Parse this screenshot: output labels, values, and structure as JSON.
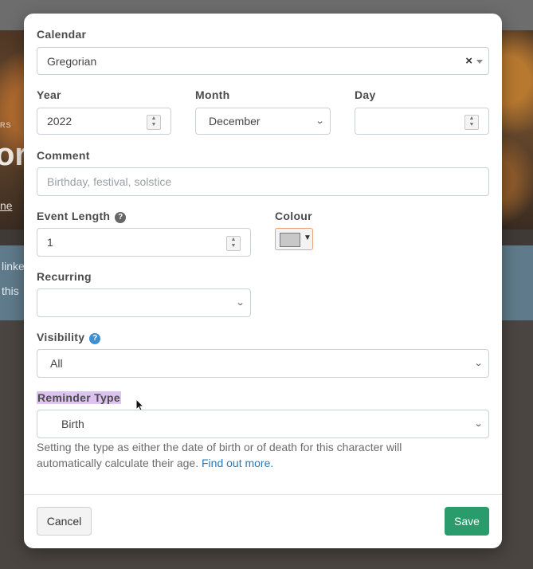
{
  "background": {
    "hero_small": "RS",
    "hero_big": "or",
    "hero_link": "ne",
    "alert_line1": "linke",
    "alert_line2": "this"
  },
  "form": {
    "calendar": {
      "label": "Calendar",
      "value": "Gregorian",
      "clear": "×"
    },
    "year": {
      "label": "Year",
      "value": "2022"
    },
    "month": {
      "label": "Month",
      "value": "December"
    },
    "day": {
      "label": "Day",
      "value": ""
    },
    "comment": {
      "label": "Comment",
      "placeholder": "Birthday, festival, solstice"
    },
    "event_length": {
      "label": "Event Length",
      "value": "1",
      "help_icon": "question-icon"
    },
    "colour": {
      "label": "Colour",
      "swatch": "#c8c8c8"
    },
    "recurring": {
      "label": "Recurring",
      "value": ""
    },
    "visibility": {
      "label": "Visibility",
      "value": "All",
      "help_icon": "question-icon"
    },
    "reminder_type": {
      "label": "Reminder Type",
      "value": "Birth",
      "help_text": "Setting the type as either the date of birth or of death for this character will automatically calculate their age.",
      "help_link": "Find out more."
    }
  },
  "footer": {
    "cancel_label": "Cancel",
    "save_label": "Save"
  },
  "colors": {
    "accent": "#2a9b6a",
    "link": "#2a77b8",
    "highlight": "#ddc3f0",
    "help_blue": "#3d8fd1",
    "help_gray": "#666666"
  }
}
